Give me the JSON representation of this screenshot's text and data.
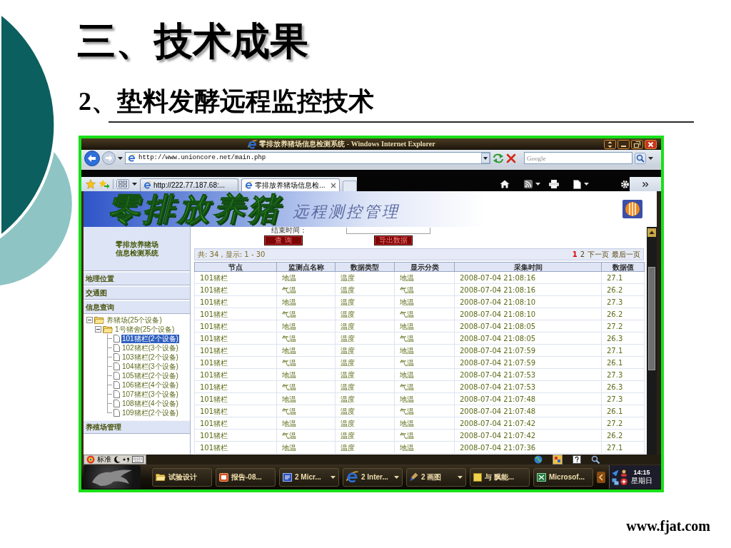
{
  "slide": {
    "title": "三、技术成果",
    "subtitle": "2、垫料发酵远程监控技术",
    "footer": "www.fjat.com"
  },
  "window": {
    "title": "零排放养猪场信息检测系统 - Windows Internet Explorer"
  },
  "address_bar": {
    "url": "http://www.unioncore.net/main.php",
    "search": {
      "placeholder": "Google"
    }
  },
  "tabs": [
    {
      "label": "http://222.77.187.68:...",
      "selected": false
    },
    {
      "label": "零排放养猪场信息检...",
      "selected": true
    }
  ],
  "banner": {
    "title": "零排放养猪",
    "subtitle": "远程测控管理"
  },
  "sidebar": {
    "system_name": [
      "零排放养猪场",
      "信息检测系统"
    ],
    "items": [
      {
        "kind": "menu",
        "label": "地理位置"
      },
      {
        "kind": "menu",
        "label": "交通图"
      },
      {
        "kind": "menu",
        "label": "信息查询"
      },
      {
        "kind": "tree",
        "nodes": [
          {
            "label": "养猪场(25个设备)",
            "expanded": true,
            "selected": false,
            "children": [
              {
                "label": "1号猪舍(25个设备)",
                "expanded": true,
                "selected": false,
                "children": [
                  {
                    "label": "101猪栏(2个设备)",
                    "selected": true
                  },
                  {
                    "label": "102猪栏(3个设备)",
                    "selected": false
                  },
                  {
                    "label": "103猪栏(2个设备)",
                    "selected": false
                  },
                  {
                    "label": "104猪栏(3个设备)",
                    "selected": false
                  },
                  {
                    "label": "105猪栏(2个设备)",
                    "selected": false
                  },
                  {
                    "label": "106猪栏(4个设备)",
                    "selected": false
                  },
                  {
                    "label": "107猪栏(3个设备)",
                    "selected": false
                  },
                  {
                    "label": "108猪栏(4个设备)",
                    "selected": false
                  },
                  {
                    "label": "109猪栏(2个设备)",
                    "selected": false
                  }
                ]
              }
            ]
          }
        ]
      },
      {
        "kind": "menu",
        "label": "养殖场管理"
      }
    ]
  },
  "query": {
    "end_time_label": "结束时间：",
    "buttons": [
      "查 询",
      "导出数据"
    ]
  },
  "pager": {
    "summary": "共: 34 , 显示: 1 - 30",
    "pages": [
      {
        "label": "1",
        "selected": true
      },
      {
        "label": "2",
        "selected": false
      }
    ],
    "links": [
      "下一页",
      "最后一页"
    ]
  },
  "table": {
    "columns": [
      "节点",
      "监测点名称",
      "数据类型",
      "显示分类",
      "采集时间",
      "数据值"
    ],
    "rows": [
      [
        "101猪栏",
        "地温",
        "温度",
        "地温",
        "2008-07-04 21:08:16",
        "27.1"
      ],
      [
        "101猪栏",
        "气温",
        "温度",
        "气温",
        "2008-07-04 21:08:16",
        "26.2"
      ],
      [
        "101猪栏",
        "地温",
        "温度",
        "地温",
        "2008-07-04 21:08:10",
        "27.3"
      ],
      [
        "101猪栏",
        "气温",
        "温度",
        "气温",
        "2008-07-04 21:08:10",
        "26.2"
      ],
      [
        "101猪栏",
        "地温",
        "温度",
        "地温",
        "2008-07-04 21:08:05",
        "27.2"
      ],
      [
        "101猪栏",
        "气温",
        "温度",
        "气温",
        "2008-07-04 21:08:05",
        "26.3"
      ],
      [
        "101猪栏",
        "地温",
        "温度",
        "地温",
        "2008-07-04 21:07:59",
        "27.1"
      ],
      [
        "101猪栏",
        "气温",
        "温度",
        "气温",
        "2008-07-04 21:07:59",
        "26.1"
      ],
      [
        "101猪栏",
        "地温",
        "温度",
        "地温",
        "2008-07-04 21:07:53",
        "27.3"
      ],
      [
        "101猪栏",
        "气温",
        "温度",
        "气温",
        "2008-07-04 21:07:53",
        "26.3"
      ],
      [
        "101猪栏",
        "地温",
        "温度",
        "地温",
        "2008-07-04 21:07:48",
        "27.3"
      ],
      [
        "101猪栏",
        "气温",
        "温度",
        "气温",
        "2008-07-04 21:07:48",
        "26.1"
      ],
      [
        "101猪栏",
        "地温",
        "温度",
        "地温",
        "2008-07-04 21:07:42",
        "27.2"
      ],
      [
        "101猪栏",
        "气温",
        "温度",
        "气温",
        "2008-07-04 21:07:42",
        "26.2"
      ],
      [
        "101猪栏",
        "地温",
        "温度",
        "地温",
        "2008-07-04 21:07:36",
        "27.1"
      ]
    ]
  },
  "ime": {
    "mode": "标准"
  },
  "taskbar": {
    "items": [
      {
        "label": "试验设计",
        "grouped": false
      },
      {
        "label": "报告-08...",
        "grouped": false
      },
      {
        "label": "2 Micr...",
        "grouped": true
      },
      {
        "label": "2 Inter...",
        "grouped": true
      },
      {
        "label": "2 画图",
        "grouped": true
      },
      {
        "label": "与 飘能...",
        "grouped": false
      },
      {
        "label": "Microsof...",
        "grouped": false
      }
    ],
    "clock": {
      "time": "14:15",
      "day": "星期日"
    }
  }
}
